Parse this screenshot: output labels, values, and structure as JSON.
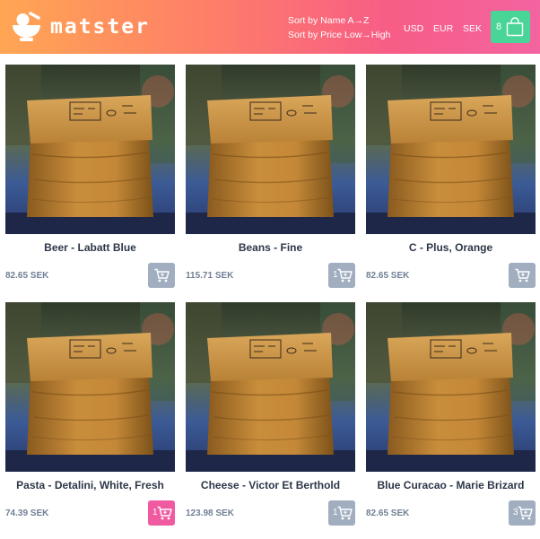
{
  "header": {
    "brand": "matster",
    "sort_options": [
      "Sort by Name A→Z",
      "Sort by Price Low→High"
    ],
    "currencies": [
      "USD",
      "EUR",
      "SEK"
    ],
    "cart_count": "8",
    "gradient": [
      "#ffa653",
      "#fe7f68",
      "#f75d86",
      "#f364a0"
    ],
    "cart_button_color": "#48d597"
  },
  "products": [
    {
      "name": "Beer - Labatt Blue",
      "price": "82.65 SEK",
      "in_cart": ""
    },
    {
      "name": "Beans - Fine",
      "price": "115.71 SEK",
      "in_cart": "1"
    },
    {
      "name": "C - Plus, Orange",
      "price": "82.65 SEK",
      "in_cart": ""
    },
    {
      "name": "Pasta - Detalini, White, Fresh",
      "price": "74.39 SEK",
      "in_cart": "1"
    },
    {
      "name": "Cheese - Victor Et Berthold",
      "price": "123.98 SEK",
      "in_cart": "1"
    },
    {
      "name": "Blue Curacao - Marie Brizard",
      "price": "82.65 SEK",
      "in_cart": "3"
    }
  ],
  "colors": {
    "add_button": "#a0aec0",
    "add_button_highlight": "#f05aa0",
    "price_text": "#718096",
    "name_text": "#2d3748"
  },
  "icons": {
    "logo": "bowl-icon",
    "cart": "shopping-bag-icon",
    "add": "cart-icon"
  }
}
